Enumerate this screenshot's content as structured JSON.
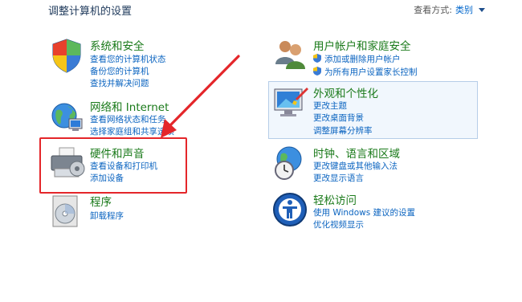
{
  "header": {
    "title": "调整计算机的设置",
    "view_by_label": "查看方式:",
    "view_by_value": "类别"
  },
  "categories": {
    "system": {
      "title": "系统和安全",
      "links": [
        "查看您的计算机状态",
        "备份您的计算机",
        "查找并解决问题"
      ]
    },
    "network": {
      "title": "网络和 Internet",
      "links": [
        "查看网络状态和任务",
        "选择家庭组和共享选项"
      ]
    },
    "hardware": {
      "title": "硬件和声音",
      "links": [
        "查看设备和打印机",
        "添加设备"
      ]
    },
    "programs": {
      "title": "程序",
      "links": [
        "卸载程序"
      ]
    },
    "users": {
      "title": "用户帐户和家庭安全",
      "links": [
        "添加或删除用户帐户",
        "为所有用户设置家长控制"
      ]
    },
    "appearance": {
      "title": "外观和个性化",
      "links": [
        "更改主题",
        "更改桌面背景",
        "调整屏幕分辨率"
      ]
    },
    "clock": {
      "title": "时钟、语言和区域",
      "links": [
        "更改键盘或其他输入法",
        "更改显示语言"
      ]
    },
    "ease": {
      "title": "轻松访问",
      "links": [
        "使用 Windows 建议的设置",
        "优化视频显示"
      ]
    }
  },
  "colors": {
    "category_title": "#1a7a1a",
    "link": "#0b64c0",
    "annotation": "#e4262a"
  }
}
